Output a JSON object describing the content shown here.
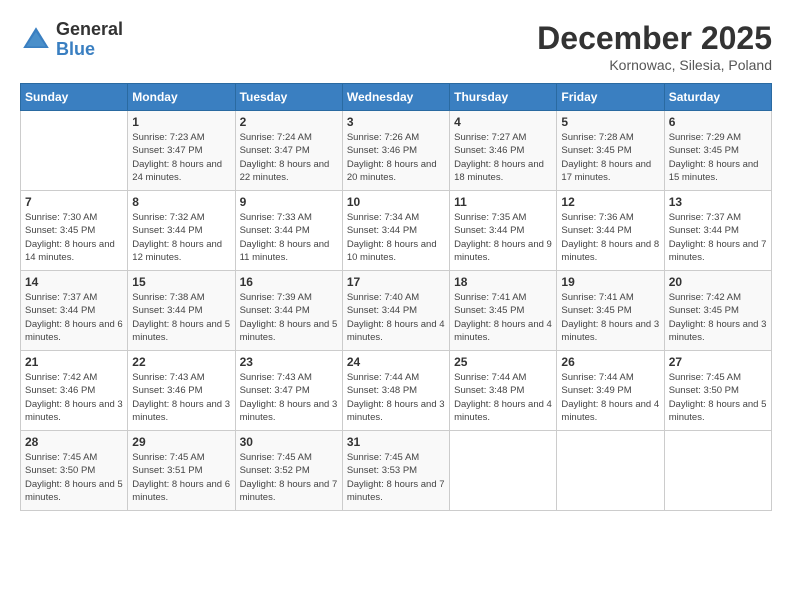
{
  "logo": {
    "general": "General",
    "blue": "Blue"
  },
  "title": {
    "month": "December 2025",
    "location": "Kornowac, Silesia, Poland"
  },
  "days_of_week": [
    "Sunday",
    "Monday",
    "Tuesday",
    "Wednesday",
    "Thursday",
    "Friday",
    "Saturday"
  ],
  "weeks": [
    [
      {
        "num": "",
        "info": ""
      },
      {
        "num": "1",
        "sunrise": "Sunrise: 7:23 AM",
        "sunset": "Sunset: 3:47 PM",
        "daylight": "Daylight: 8 hours and 24 minutes."
      },
      {
        "num": "2",
        "sunrise": "Sunrise: 7:24 AM",
        "sunset": "Sunset: 3:47 PM",
        "daylight": "Daylight: 8 hours and 22 minutes."
      },
      {
        "num": "3",
        "sunrise": "Sunrise: 7:26 AM",
        "sunset": "Sunset: 3:46 PM",
        "daylight": "Daylight: 8 hours and 20 minutes."
      },
      {
        "num": "4",
        "sunrise": "Sunrise: 7:27 AM",
        "sunset": "Sunset: 3:46 PM",
        "daylight": "Daylight: 8 hours and 18 minutes."
      },
      {
        "num": "5",
        "sunrise": "Sunrise: 7:28 AM",
        "sunset": "Sunset: 3:45 PM",
        "daylight": "Daylight: 8 hours and 17 minutes."
      },
      {
        "num": "6",
        "sunrise": "Sunrise: 7:29 AM",
        "sunset": "Sunset: 3:45 PM",
        "daylight": "Daylight: 8 hours and 15 minutes."
      }
    ],
    [
      {
        "num": "7",
        "sunrise": "Sunrise: 7:30 AM",
        "sunset": "Sunset: 3:45 PM",
        "daylight": "Daylight: 8 hours and 14 minutes."
      },
      {
        "num": "8",
        "sunrise": "Sunrise: 7:32 AM",
        "sunset": "Sunset: 3:44 PM",
        "daylight": "Daylight: 8 hours and 12 minutes."
      },
      {
        "num": "9",
        "sunrise": "Sunrise: 7:33 AM",
        "sunset": "Sunset: 3:44 PM",
        "daylight": "Daylight: 8 hours and 11 minutes."
      },
      {
        "num": "10",
        "sunrise": "Sunrise: 7:34 AM",
        "sunset": "Sunset: 3:44 PM",
        "daylight": "Daylight: 8 hours and 10 minutes."
      },
      {
        "num": "11",
        "sunrise": "Sunrise: 7:35 AM",
        "sunset": "Sunset: 3:44 PM",
        "daylight": "Daylight: 8 hours and 9 minutes."
      },
      {
        "num": "12",
        "sunrise": "Sunrise: 7:36 AM",
        "sunset": "Sunset: 3:44 PM",
        "daylight": "Daylight: 8 hours and 8 minutes."
      },
      {
        "num": "13",
        "sunrise": "Sunrise: 7:37 AM",
        "sunset": "Sunset: 3:44 PM",
        "daylight": "Daylight: 8 hours and 7 minutes."
      }
    ],
    [
      {
        "num": "14",
        "sunrise": "Sunrise: 7:37 AM",
        "sunset": "Sunset: 3:44 PM",
        "daylight": "Daylight: 8 hours and 6 minutes."
      },
      {
        "num": "15",
        "sunrise": "Sunrise: 7:38 AM",
        "sunset": "Sunset: 3:44 PM",
        "daylight": "Daylight: 8 hours and 5 minutes."
      },
      {
        "num": "16",
        "sunrise": "Sunrise: 7:39 AM",
        "sunset": "Sunset: 3:44 PM",
        "daylight": "Daylight: 8 hours and 5 minutes."
      },
      {
        "num": "17",
        "sunrise": "Sunrise: 7:40 AM",
        "sunset": "Sunset: 3:44 PM",
        "daylight": "Daylight: 8 hours and 4 minutes."
      },
      {
        "num": "18",
        "sunrise": "Sunrise: 7:41 AM",
        "sunset": "Sunset: 3:45 PM",
        "daylight": "Daylight: 8 hours and 4 minutes."
      },
      {
        "num": "19",
        "sunrise": "Sunrise: 7:41 AM",
        "sunset": "Sunset: 3:45 PM",
        "daylight": "Daylight: 8 hours and 3 minutes."
      },
      {
        "num": "20",
        "sunrise": "Sunrise: 7:42 AM",
        "sunset": "Sunset: 3:45 PM",
        "daylight": "Daylight: 8 hours and 3 minutes."
      }
    ],
    [
      {
        "num": "21",
        "sunrise": "Sunrise: 7:42 AM",
        "sunset": "Sunset: 3:46 PM",
        "daylight": "Daylight: 8 hours and 3 minutes."
      },
      {
        "num": "22",
        "sunrise": "Sunrise: 7:43 AM",
        "sunset": "Sunset: 3:46 PM",
        "daylight": "Daylight: 8 hours and 3 minutes."
      },
      {
        "num": "23",
        "sunrise": "Sunrise: 7:43 AM",
        "sunset": "Sunset: 3:47 PM",
        "daylight": "Daylight: 8 hours and 3 minutes."
      },
      {
        "num": "24",
        "sunrise": "Sunrise: 7:44 AM",
        "sunset": "Sunset: 3:48 PM",
        "daylight": "Daylight: 8 hours and 3 minutes."
      },
      {
        "num": "25",
        "sunrise": "Sunrise: 7:44 AM",
        "sunset": "Sunset: 3:48 PM",
        "daylight": "Daylight: 8 hours and 4 minutes."
      },
      {
        "num": "26",
        "sunrise": "Sunrise: 7:44 AM",
        "sunset": "Sunset: 3:49 PM",
        "daylight": "Daylight: 8 hours and 4 minutes."
      },
      {
        "num": "27",
        "sunrise": "Sunrise: 7:45 AM",
        "sunset": "Sunset: 3:50 PM",
        "daylight": "Daylight: 8 hours and 5 minutes."
      }
    ],
    [
      {
        "num": "28",
        "sunrise": "Sunrise: 7:45 AM",
        "sunset": "Sunset: 3:50 PM",
        "daylight": "Daylight: 8 hours and 5 minutes."
      },
      {
        "num": "29",
        "sunrise": "Sunrise: 7:45 AM",
        "sunset": "Sunset: 3:51 PM",
        "daylight": "Daylight: 8 hours and 6 minutes."
      },
      {
        "num": "30",
        "sunrise": "Sunrise: 7:45 AM",
        "sunset": "Sunset: 3:52 PM",
        "daylight": "Daylight: 8 hours and 7 minutes."
      },
      {
        "num": "31",
        "sunrise": "Sunrise: 7:45 AM",
        "sunset": "Sunset: 3:53 PM",
        "daylight": "Daylight: 8 hours and 7 minutes."
      },
      {
        "num": "",
        "info": ""
      },
      {
        "num": "",
        "info": ""
      },
      {
        "num": "",
        "info": ""
      }
    ]
  ]
}
